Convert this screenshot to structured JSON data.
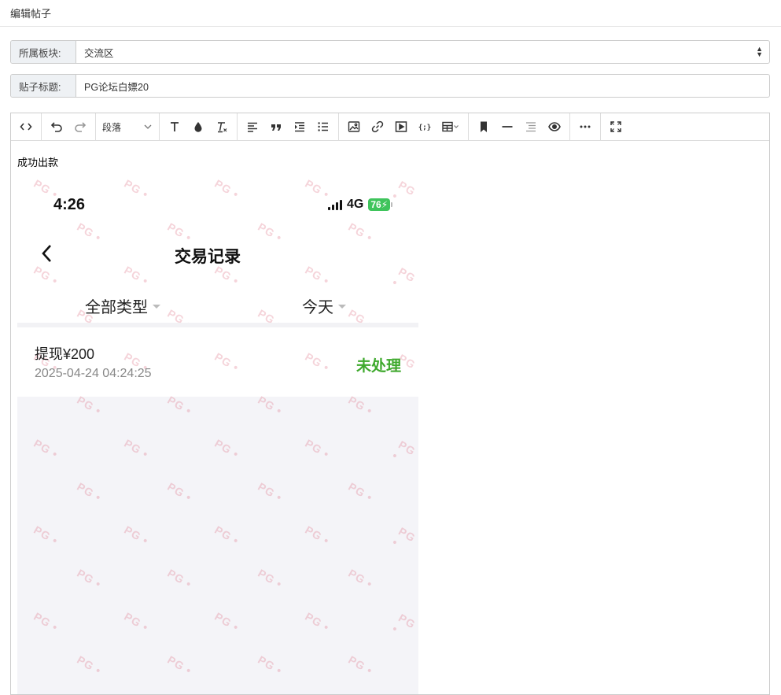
{
  "page": {
    "title": "编辑帖子"
  },
  "form": {
    "board": {
      "label": "所属板块:",
      "value": "交流区"
    },
    "post_title": {
      "label": "贴子标题:",
      "value": "PG论坛白嫖20"
    }
  },
  "toolbar": {
    "paragraph_label": "段落",
    "icons": [
      "code-view-icon",
      "undo-icon",
      "redo-icon",
      "paragraph-select",
      "text-style-icon",
      "color-icon",
      "clear-format-icon",
      "align-left-icon",
      "quote-icon",
      "indent-icon",
      "bullet-list-icon",
      "image-icon",
      "link-icon",
      "video-icon",
      "code-block-icon",
      "table-icon",
      "bookmark-icon",
      "horizontal-rule-icon",
      "toc-icon",
      "preview-icon",
      "more-icon",
      "fullscreen-icon"
    ]
  },
  "content": {
    "text": "成功出款",
    "screenshot": {
      "status_time": "4:26",
      "network": "4G",
      "battery": "76",
      "nav_title": "交易记录",
      "filters": [
        "全部类型",
        "今天"
      ],
      "transaction": {
        "title": "提现¥200",
        "time": "2025-04-24 04:24:25",
        "status": "未处理"
      },
      "watermark": "PG"
    }
  },
  "colors": {
    "status_green": "#3fa92d",
    "battery_green": "#3fc45c"
  }
}
